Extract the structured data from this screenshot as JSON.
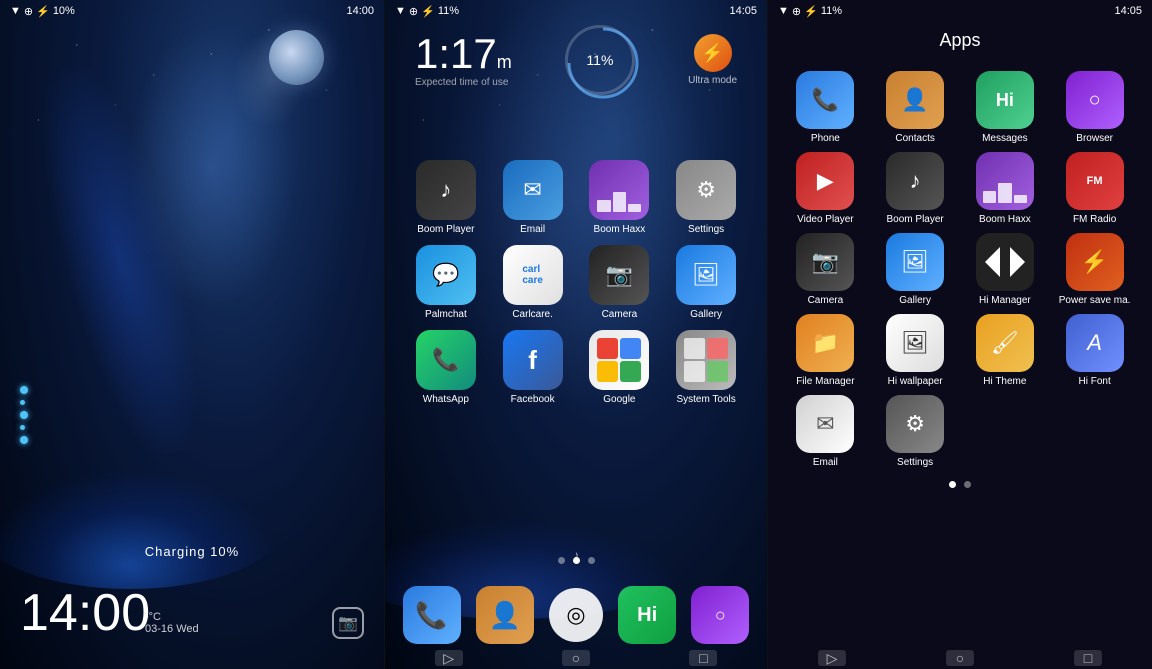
{
  "panel1": {
    "status": {
      "left": "🔋",
      "battery_pct": "10%",
      "time": "14:00"
    },
    "time_display": "14:00",
    "time_suffix": "-°C",
    "date": "03-16 Wed",
    "charging": "Charging 10%"
  },
  "panel2": {
    "status_time": "14:05",
    "battery_pct": "11%",
    "widget": {
      "time": "1:17",
      "time_sub": "m",
      "expected": "Expected time of use",
      "battery_circle": "11%",
      "ultra_label": "Ultra mode"
    },
    "apps": [
      {
        "label": "Boom Player",
        "icon": "boom-player"
      },
      {
        "label": "Email",
        "icon": "email-home"
      },
      {
        "label": "Boom Haxx",
        "icon": "boom-haxx"
      },
      {
        "label": "Settings",
        "icon": "settings-home"
      },
      {
        "label": "Palmchat",
        "icon": "palmchat"
      },
      {
        "label": "Carlcare.",
        "icon": "carlcare"
      },
      {
        "label": "Camera",
        "icon": "camera-home"
      },
      {
        "label": "Gallery",
        "icon": "gallery-home"
      },
      {
        "label": "WhatsApp",
        "icon": "whatsapp"
      },
      {
        "label": "Facebook",
        "icon": "facebook"
      },
      {
        "label": "Google",
        "icon": "google"
      },
      {
        "label": "System Tools",
        "icon": "system-tools"
      }
    ],
    "dock": [
      {
        "label": "Phone",
        "icon": "dock-phone"
      },
      {
        "label": "Contacts",
        "icon": "dock-contacts"
      },
      {
        "label": "Target",
        "icon": "dock-target"
      },
      {
        "label": "Hi",
        "icon": "dock-hi"
      },
      {
        "label": "Browser",
        "icon": "dock-browser"
      }
    ]
  },
  "panel3": {
    "status_time": "14:05",
    "battery_pct": "11%",
    "title": "Apps",
    "apps": [
      {
        "label": "Phone",
        "icon": "phone-d"
      },
      {
        "label": "Contacts",
        "icon": "contacts-d"
      },
      {
        "label": "Messages",
        "icon": "messages-d"
      },
      {
        "label": "Browser",
        "icon": "browser-d"
      },
      {
        "label": "Video Player",
        "icon": "video-d"
      },
      {
        "label": "Boom Player",
        "icon": "boom-d"
      },
      {
        "label": "Boom Haxx",
        "icon": "boomhaxx-d"
      },
      {
        "label": "FM Radio",
        "icon": "fmradio-d"
      },
      {
        "label": "Camera",
        "icon": "camera-d"
      },
      {
        "label": "Gallery",
        "icon": "gallery-d"
      },
      {
        "label": "Hi Manager",
        "icon": "himanager-d"
      },
      {
        "label": "Power save ma.",
        "icon": "powersave-d"
      },
      {
        "label": "File Manager",
        "icon": "filemanager-d"
      },
      {
        "label": "Hi wallpaper",
        "icon": "hiwallpaper-d"
      },
      {
        "label": "Hi Theme",
        "icon": "hitheme-d"
      },
      {
        "label": "Hi Font",
        "icon": "hifont-d"
      },
      {
        "label": "Email",
        "icon": "email-d"
      },
      {
        "label": "Settings",
        "icon": "settings-d"
      }
    ]
  }
}
